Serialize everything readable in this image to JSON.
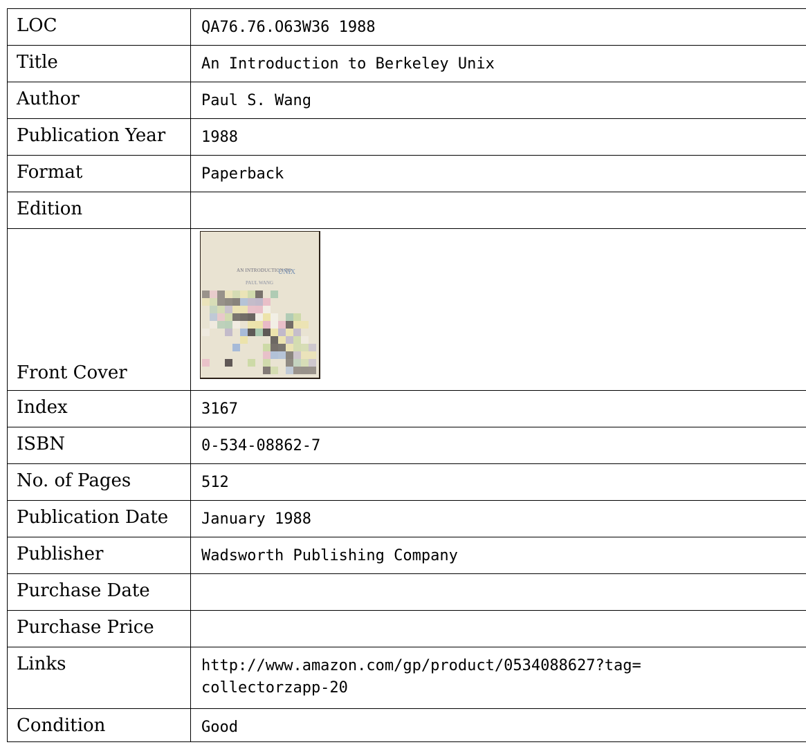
{
  "rows": [
    {
      "label": "LOC",
      "value": "QA76.76.O63W36 1988"
    },
    {
      "label": "Title",
      "value": "An Introduction to Berkeley Unix"
    },
    {
      "label": "Author",
      "value": "Paul S. Wang"
    },
    {
      "label": "Publication Year",
      "value": "1988"
    },
    {
      "label": "Format",
      "value": "Paperback"
    },
    {
      "label": "Edition",
      "value": ""
    },
    {
      "label": "Front Cover",
      "value": ""
    },
    {
      "label": "Index",
      "value": "3167"
    },
    {
      "label": "ISBN",
      "value": "0-534-08862-7"
    },
    {
      "label": "No. of Pages",
      "value": "512"
    },
    {
      "label": "Publication Date",
      "value": "January 1988"
    },
    {
      "label": "Publisher",
      "value": "Wadsworth Publishing Company"
    },
    {
      "label": "Purchase Date",
      "value": ""
    },
    {
      "label": "Purchase Price",
      "value": ""
    },
    {
      "label": "Links",
      "value_line1": "http://www.amazon.com/gp/product/0534088627?tag=",
      "value_line2": "collectorzapp-20"
    },
    {
      "label": "Condition",
      "value": "Good"
    }
  ],
  "cover": {
    "line1": "AN INTRODUCTION TO",
    "line2": "UNIX",
    "line3": "PAUL WANG",
    "background_color": "#e9e3d2"
  }
}
